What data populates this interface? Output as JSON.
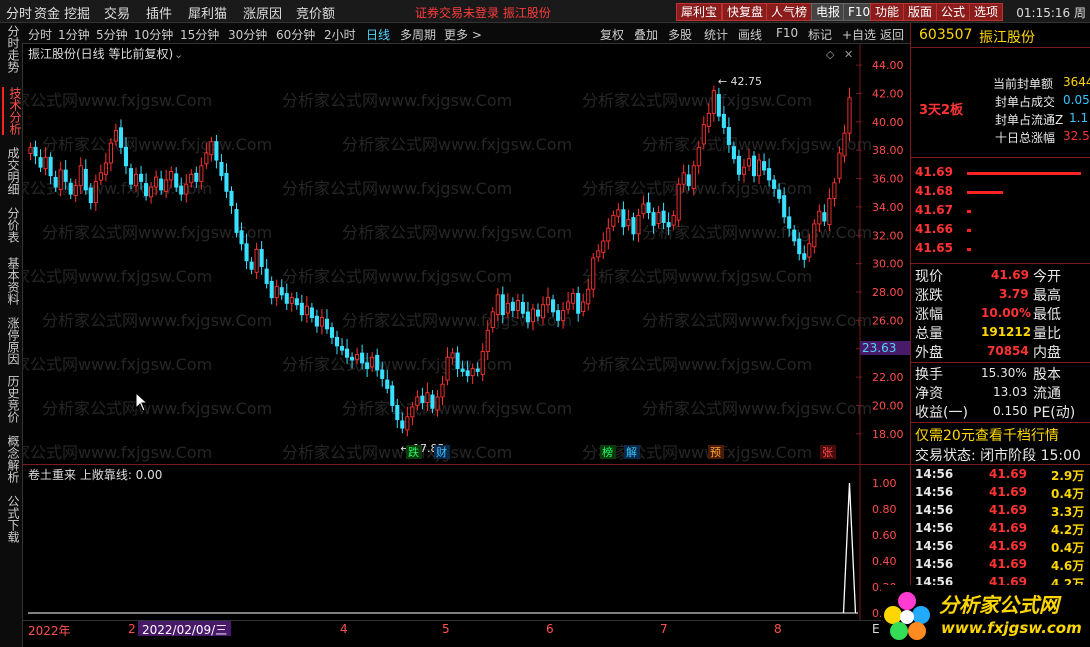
{
  "menu": {
    "items": [
      "分时",
      "资金",
      "挖掘",
      "交易",
      "插件",
      "犀利猫",
      "涨原因",
      "竞价额"
    ],
    "notice": "证券交易未登录  振江股份",
    "buttons": [
      "犀利宝",
      "快复盘",
      "人气榜",
      "电报",
      "F10",
      "功能",
      "版面",
      "公式",
      "选项"
    ],
    "clock": "01:15:16 周"
  },
  "periods": {
    "items": [
      "分时",
      "1分钟",
      "5分钟",
      "10分钟",
      "15分钟",
      "30分钟",
      "60分钟",
      "2小时",
      "日线",
      "多周期",
      "更多 >"
    ],
    "active": "日线",
    "tools": [
      "复权",
      "叠加",
      "多股",
      "统计",
      "画线",
      "F10",
      "标记",
      "+自选",
      "返回"
    ]
  },
  "left_tabs": [
    {
      "label": "分时走势",
      "active": false
    },
    {
      "label": "技术分析",
      "active": true
    },
    {
      "label": "成交明细",
      "active": false
    },
    {
      "label": "分价表",
      "active": false
    },
    {
      "label": "基本资料",
      "active": false
    },
    {
      "label": "涨停原因",
      "active": false
    },
    {
      "label": "历史竞价",
      "active": false
    },
    {
      "label": "概念解析",
      "active": false
    },
    {
      "label": "公式下载",
      "active": false
    }
  ],
  "chart": {
    "title": "振江股份(日线 等比前复权)",
    "current_price_tag": "23.63",
    "high_label": "42.75",
    "low_label": "17.85",
    "event_markers": [
      "跌",
      "财",
      "榜",
      "解",
      "预",
      "张"
    ],
    "sub_title": "卷土重来  上敞靠线: 0.00",
    "date_label": "2022/02/09/三",
    "x_labels": [
      "2022年",
      "2",
      "4",
      "5",
      "6",
      "7",
      "8"
    ],
    "bottom_right": "E"
  },
  "chart_data": {
    "type": "candlestick",
    "y_axis_ticks": [
      "44.00",
      "42.00",
      "40.00",
      "38.00",
      "36.00",
      "34.00",
      "32.00",
      "30.00",
      "28.00",
      "26.00",
      "24.00",
      "22.00",
      "20.00",
      "18.00"
    ],
    "ylim": [
      17,
      44.5
    ],
    "closes": [
      38.2,
      37.6,
      36.8,
      37.5,
      36.2,
      35.4,
      36.6,
      35.8,
      34.9,
      35.5,
      36.9,
      35.2,
      34.3,
      35.8,
      36.4,
      37.1,
      38.5,
      39.4,
      38.2,
      36.9,
      35.6,
      36.3,
      35.8,
      34.8,
      35.4,
      36.1,
      35.2,
      35.9,
      36.5,
      35.4,
      34.9,
      35.6,
      36.3,
      35.8,
      36.9,
      37.8,
      38.6,
      37.3,
      36.2,
      35.1,
      34.1,
      32.2,
      31.4,
      30.2,
      29.6,
      31.0,
      29.8,
      28.6,
      27.6,
      28.4,
      27.8,
      27.2,
      27.6,
      27.1,
      26.4,
      27.0,
      26.2,
      25.6,
      26.2,
      25.4,
      24.8,
      24.2,
      23.9,
      23.4,
      23.2,
      23.6,
      23.0,
      22.6,
      23.4,
      22.5,
      21.9,
      21.2,
      20.0,
      19.0,
      18.4,
      19.2,
      19.9,
      20.6,
      20.2,
      20.9,
      19.8,
      20.6,
      21.5,
      23.4,
      23.7,
      22.6,
      22.4,
      22.1,
      22.6,
      22.4,
      23.8,
      25.3,
      26.6,
      27.8,
      26.4,
      27.2,
      26.7,
      27.4,
      26.5,
      25.9,
      26.8,
      26.3,
      27.1,
      27.6,
      26.6,
      26.0,
      26.7,
      27.3,
      27.9,
      26.5,
      27.3,
      28.2,
      30.4,
      30.9,
      31.6,
      32.5,
      33.4,
      33.8,
      32.6,
      33.1,
      32.1,
      33.4,
      34.2,
      33.6,
      32.7,
      33.6,
      32.9,
      32.6,
      33.4,
      35.6,
      36.4,
      35.5,
      36.9,
      38.2,
      39.8,
      40.6,
      42.2,
      40.4,
      39.6,
      38.4,
      37.4,
      36.3,
      36.8,
      37.4,
      36.2,
      37.3,
      36.6,
      35.9,
      35.3,
      34.6,
      33.3,
      32.5,
      31.6,
      30.7,
      30.3,
      31.4,
      32.8,
      33.7,
      33.0,
      34.6,
      35.7,
      37.8,
      39.2,
      41.69
    ],
    "volume_signal_index": 163,
    "signal_ylim": [
      0,
      1.0
    ],
    "sub_axis_ticks": [
      "1.00",
      "0.80",
      "0.60",
      "0.40",
      "0.20",
      "0.00"
    ]
  },
  "stock": {
    "code": "603507",
    "name": "振江股份",
    "board_tag": "3天2板",
    "seal_rows": [
      {
        "label": "当前封单额",
        "value": "3644"
      },
      {
        "label": "封单占成交",
        "value": "0.05"
      },
      {
        "label": "封单占流通Z",
        "value": "1.1"
      },
      {
        "label": "十日总涨幅",
        "value": "32.5"
      }
    ],
    "bids": [
      {
        "price": "41.69",
        "bar": 0.95
      },
      {
        "price": "41.68",
        "bar": 0.3
      },
      {
        "price": "41.67",
        "bar": 0.03
      },
      {
        "price": "41.66",
        "bar": 0.03
      },
      {
        "price": "41.65",
        "bar": 0.03
      }
    ],
    "quote": [
      {
        "label": "现价",
        "value": "41.69",
        "label2": "今开"
      },
      {
        "label": "涨跌",
        "value": "3.79",
        "label2": "最高"
      },
      {
        "label": "涨幅",
        "value": "10.00%",
        "label2": "最低"
      },
      {
        "label": "总量",
        "value": "191212",
        "label2": "量比"
      },
      {
        "label": "外盘",
        "value": "70854",
        "label2": "内盘"
      }
    ],
    "finance": [
      {
        "label": "换手",
        "value": "15.30%",
        "label2": "股本"
      },
      {
        "label": "净资",
        "value": "13.03",
        "label2": "流通"
      },
      {
        "label": "收益(一)",
        "value": "0.150",
        "label2": "PE(动)"
      }
    ],
    "promo": "仅需20元查看千档行情",
    "trade_status": "交易状态: 闭市阶段 15:00",
    "ticks": [
      {
        "time": "14:56",
        "price": "41.69",
        "vol": "2.9万"
      },
      {
        "time": "14:56",
        "price": "41.69",
        "vol": "0.4万"
      },
      {
        "time": "14:56",
        "price": "41.69",
        "vol": "3.3万"
      },
      {
        "time": "14:56",
        "price": "41.69",
        "vol": "4.2万"
      },
      {
        "time": "14:56",
        "price": "41.69",
        "vol": "0.4万"
      },
      {
        "time": "14:56",
        "price": "41.69",
        "vol": "4.6万"
      },
      {
        "time": "14:56",
        "price": "41.69",
        "vol": "4.2万"
      }
    ],
    "logo_text": "分析家公式网",
    "logo_url": "www.fxjgsw.com"
  },
  "watermark": "分析家公式网www.fxjgsw.Com",
  "colors": {
    "up": "#ff3333",
    "down": "#39e0ff",
    "accent": "#ff2222",
    "bg": "#000000"
  }
}
